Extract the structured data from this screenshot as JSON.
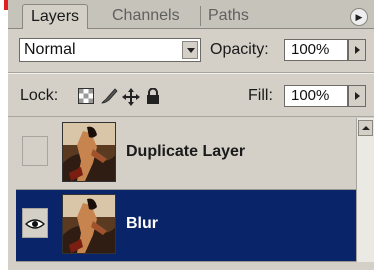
{
  "tabs": [
    {
      "label": "Layers",
      "active": true
    },
    {
      "label": "Channels",
      "active": false
    },
    {
      "label": "Paths",
      "active": false
    }
  ],
  "blend_mode": {
    "value": "Normal"
  },
  "opacity": {
    "label": "Opacity:",
    "value": "100%"
  },
  "lock": {
    "label": "Lock:",
    "icons": [
      "lock-transparency-icon",
      "lock-paint-icon",
      "lock-move-icon",
      "lock-all-icon"
    ]
  },
  "fill": {
    "label": "Fill:",
    "value": "100%"
  },
  "layers": [
    {
      "name": "Duplicate Layer",
      "visible": false,
      "selected": false
    },
    {
      "name": "Blur",
      "visible": true,
      "selected": true
    }
  ],
  "colors": {
    "selection": "#0a246a",
    "panel": "#d4d0c8",
    "accent": "#e02020"
  }
}
